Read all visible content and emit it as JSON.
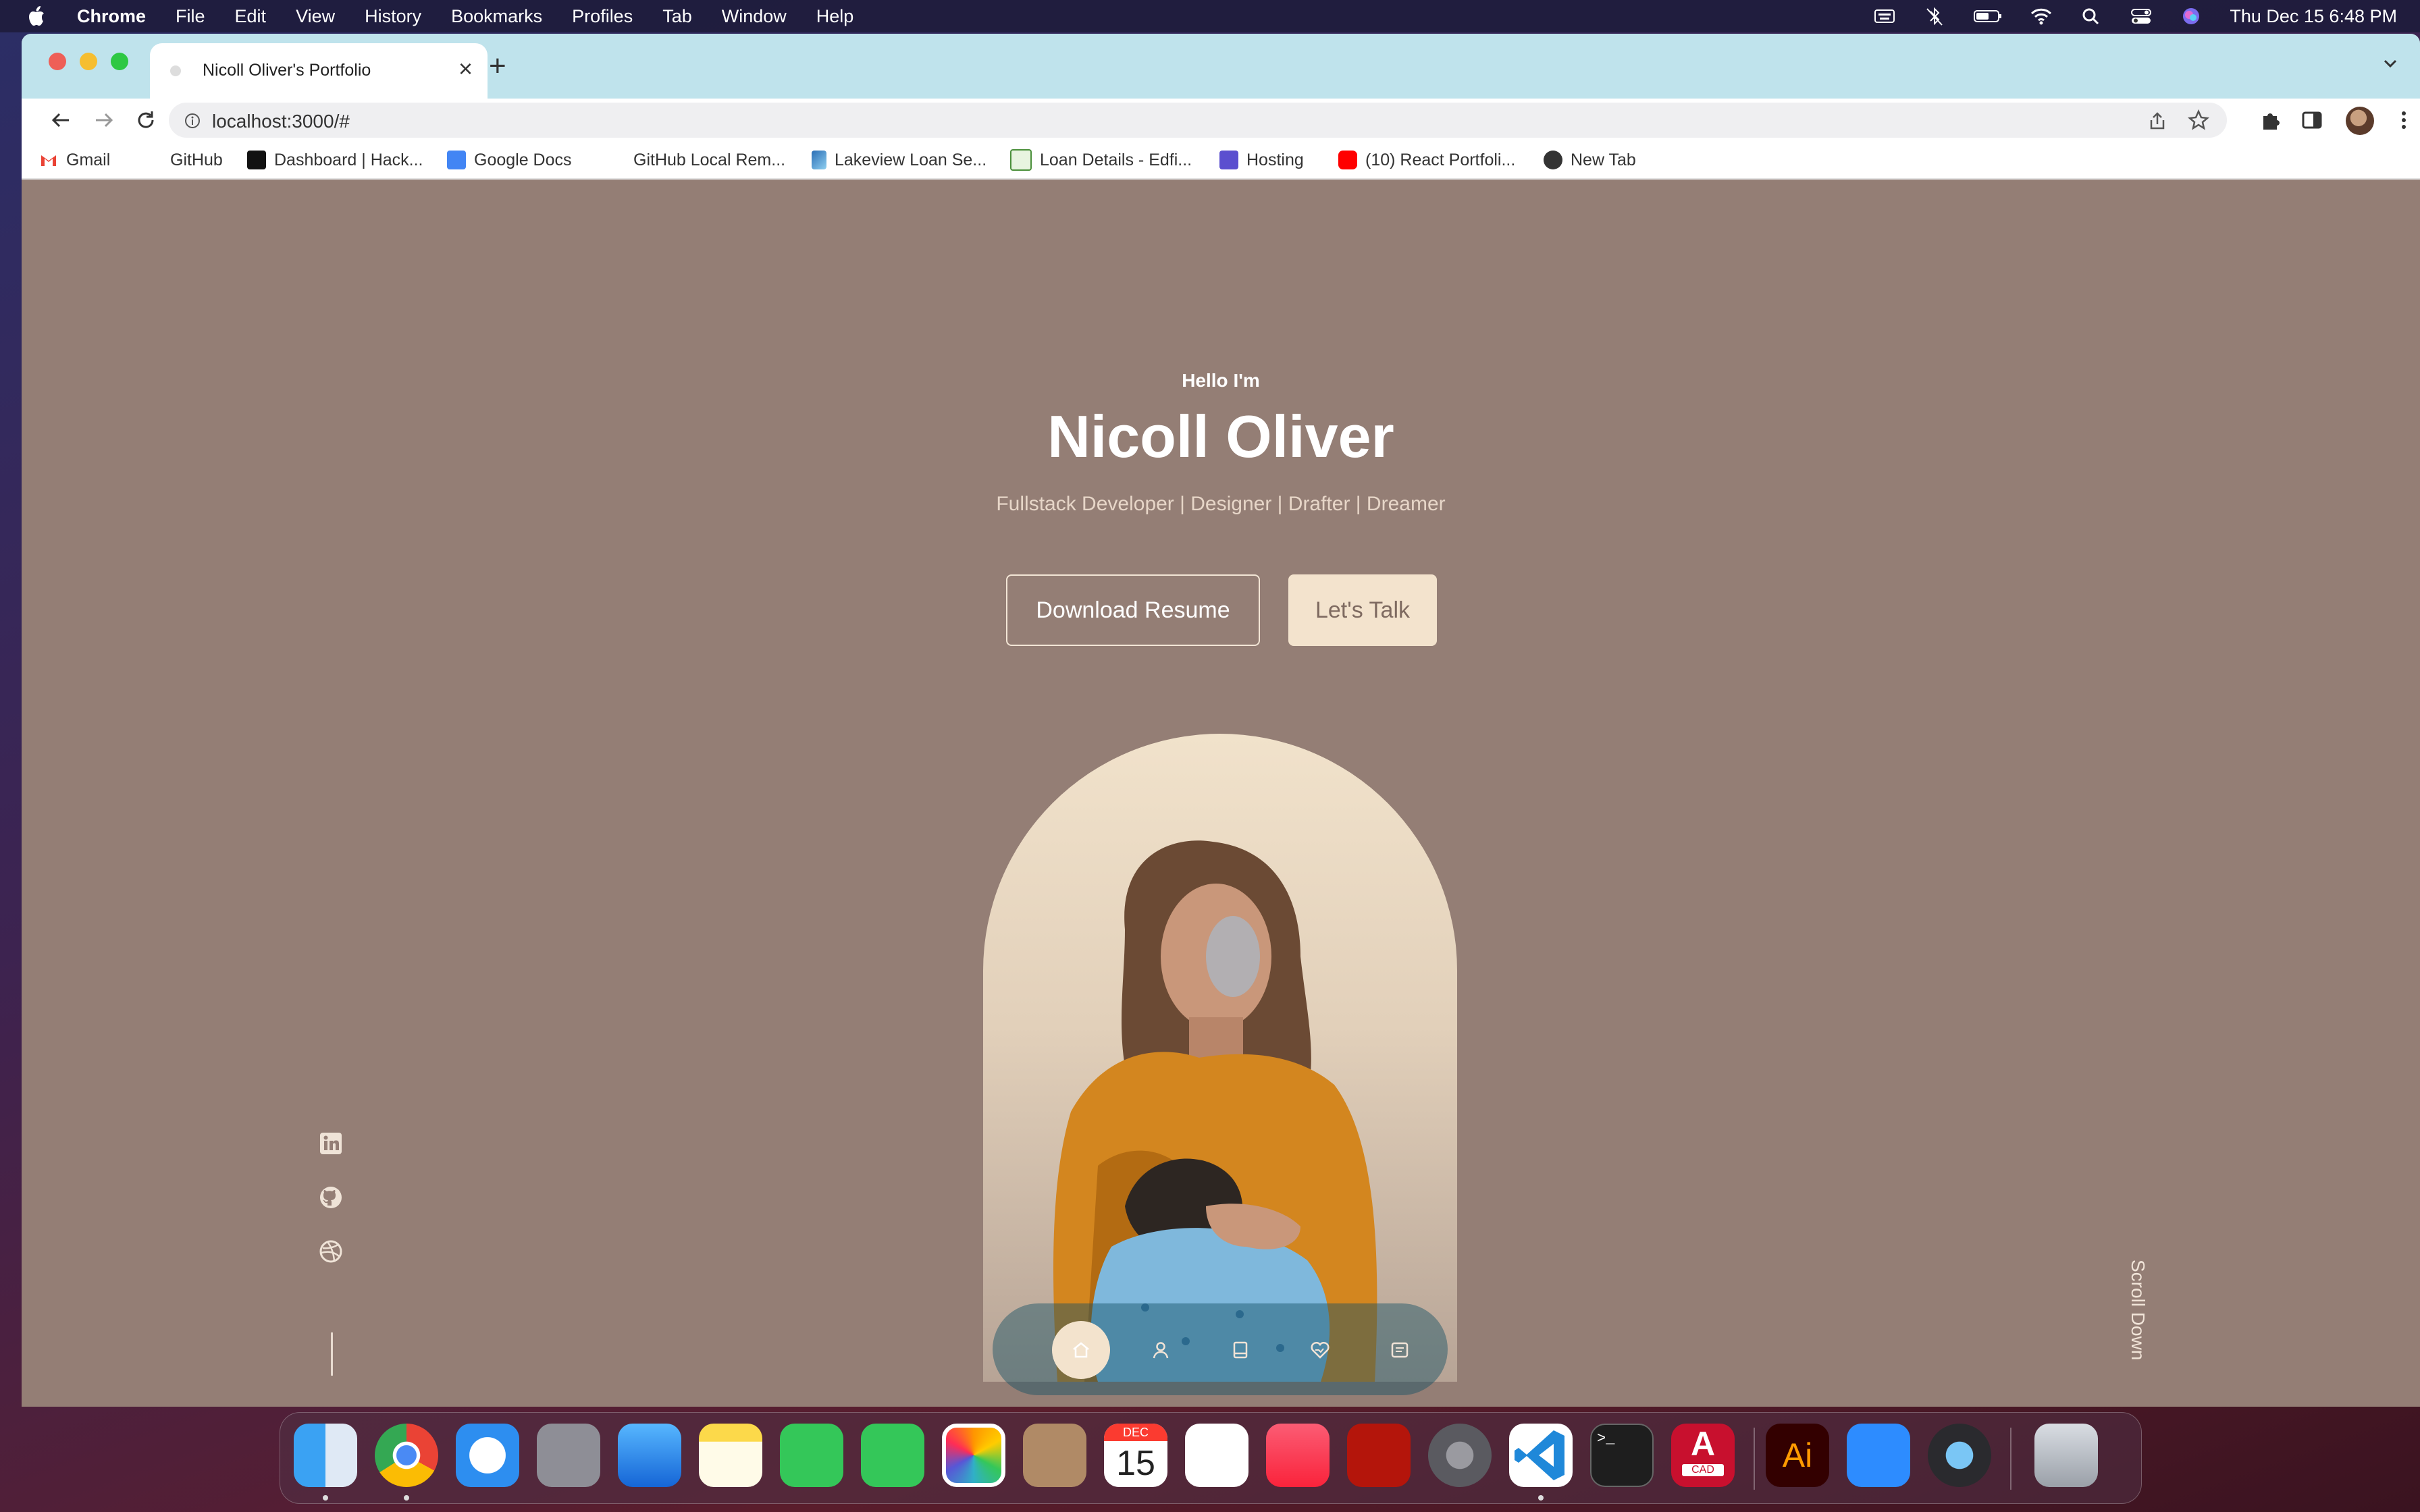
{
  "menubar": {
    "app_name": "Chrome",
    "items": [
      "File",
      "Edit",
      "View",
      "History",
      "Bookmarks",
      "Profiles",
      "Tab",
      "Window",
      "Help"
    ],
    "clock": "Thu Dec 15  6:48 PM"
  },
  "browser": {
    "tab_title": "Nicoll Oliver's Portfolio",
    "url": "localhost:3000/#",
    "bookmarks": [
      "Gmail",
      "GitHub",
      "Dashboard | Hack...",
      "Google Docs",
      "GitHub Local Rem...",
      "Lakeview Loan Se...",
      "Loan Details - Edfi...",
      "Hosting",
      "(10) React Portfoli...",
      "New Tab"
    ]
  },
  "hero": {
    "greeting": "Hello I'm",
    "name": "Nicoll Oliver",
    "roles": "Fullstack Developer | Designer | Drafter | Dreamer",
    "download_label": "Download Resume",
    "talk_label": "Let's Talk",
    "scroll_label": "Scroll Down"
  },
  "socials": [
    "linkedin-icon",
    "github-icon",
    "dribbble-icon"
  ],
  "nav": {
    "items": [
      "home-icon",
      "user-icon",
      "book-icon",
      "services-icon",
      "message-icon"
    ],
    "active": "home-icon"
  },
  "dock": {
    "calendar_month": "DEC",
    "calendar_day": "15",
    "illustrator_label": "Ai",
    "autocad_label": "CAD"
  },
  "colors": {
    "page_bg": "#947e75",
    "accent": "#f3e3cd",
    "tab_strip": "#bfe3ec"
  }
}
